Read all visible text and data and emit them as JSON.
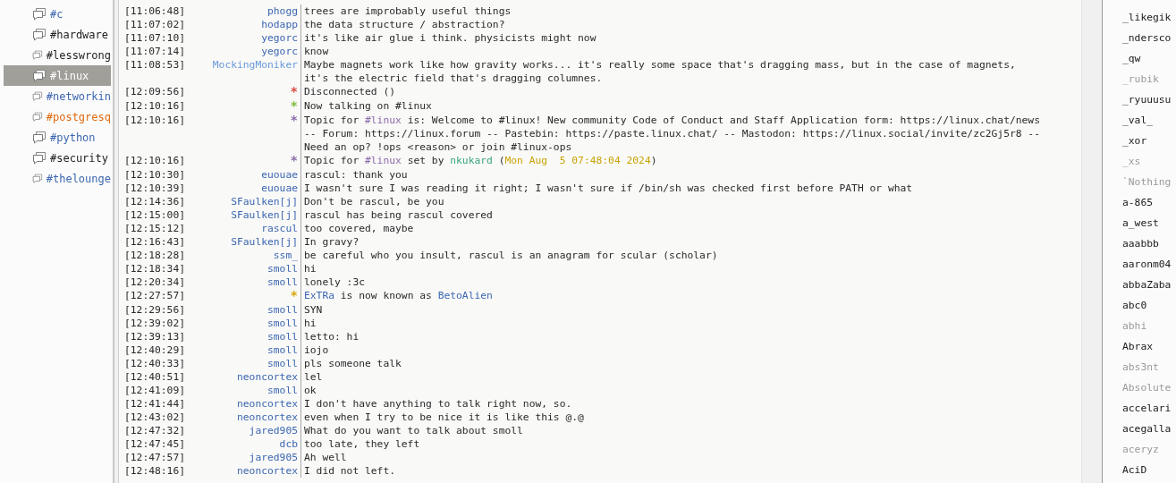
{
  "channels": [
    {
      "name": "#c",
      "color": "#3c67b0",
      "selected": false
    },
    {
      "name": "#hardware",
      "color": "#222222",
      "selected": false
    },
    {
      "name": "#lesswrong",
      "color": "#222222",
      "selected": false
    },
    {
      "name": "#linux",
      "color": "#ffffff",
      "selected": true
    },
    {
      "name": "#networkin",
      "color": "#3c67b0",
      "selected": false
    },
    {
      "name": "#postgresq",
      "color": "#e06a10",
      "selected": false
    },
    {
      "name": "#python",
      "color": "#3c67b0",
      "selected": false
    },
    {
      "name": "#security",
      "color": "#222222",
      "selected": false
    },
    {
      "name": "#thelounge",
      "color": "#3c67b0",
      "selected": false
    }
  ],
  "messages": [
    {
      "time": "[11:06:48]",
      "nick": "phogg",
      "color": "#3c67b0",
      "text": "trees are improbably useful things"
    },
    {
      "time": "[11:07:02]",
      "nick": "hodapp",
      "color": "#3c67b0",
      "text": "the data structure / abstraction?"
    },
    {
      "time": "[11:07:10]",
      "nick": "yegorc",
      "color": "#3c67b0",
      "text": "it's like air glue i think. physicists might now"
    },
    {
      "time": "[11:07:14]",
      "nick": "yegorc",
      "color": "#3c67b0",
      "text": "know"
    },
    {
      "time": "[11:08:53]",
      "nick": "MockingMoniker",
      "color": "#6a9ad8",
      "text": "Maybe magnets work like how gravity works... it's really some space that's dragging mass, but in the case of magnets, it's the electric field that's dragging columnes."
    },
    {
      "time": "[12:09:56]",
      "nick": "*",
      "kind": "event",
      "color": "#d9443c",
      "text": "Disconnected ()"
    },
    {
      "time": "[12:10:16]",
      "nick": "*",
      "kind": "event",
      "color": "#7dbb3c",
      "text": "Now talking on #linux"
    },
    {
      "time": "[12:10:16]",
      "nick": "*",
      "kind": "event",
      "color": "#8a6aa8",
      "parts": [
        {
          "text": "Topic for "
        },
        {
          "text": "#linux",
          "color": "#8a6aa8"
        },
        {
          "text": " is: Welcome to #linux! New community Code of Conduct and Staff Application form: https://linux.chat/news -- Forum: https://linux.forum -- Pastebin: https://paste.linux.chat/ -- Mastodon: https://linux.social/invite/zc2Gj5r8 -- Need an op? !ops <reason> or join #linux-ops"
        }
      ]
    },
    {
      "time": "[12:10:16]",
      "nick": "*",
      "kind": "event",
      "color": "#8a6aa8",
      "parts": [
        {
          "text": "Topic for "
        },
        {
          "text": "#linux",
          "color": "#8a6aa8"
        },
        {
          "text": " set by "
        },
        {
          "text": "nkukard",
          "color": "#3aa57a"
        },
        {
          "text": " ("
        },
        {
          "text": "Mon Aug  5 07:48:04 2024",
          "color": "#c9a200"
        },
        {
          "text": ")"
        }
      ]
    },
    {
      "time": "[12:10:30]",
      "nick": "euouae",
      "color": "#3c67b0",
      "text": "rascul: thank you"
    },
    {
      "time": "[12:10:39]",
      "nick": "euouae",
      "color": "#3c67b0",
      "text": "I wasn't sure I was reading it right; I wasn't sure if /bin/sh was checked first before PATH or what"
    },
    {
      "time": "[12:14:36]",
      "nick": "SFaulken[j]",
      "color": "#3c67b0",
      "text": "Don't be rascul, be you"
    },
    {
      "time": "[12:15:00]",
      "nick": "SFaulken[j]",
      "color": "#3c67b0",
      "text": "rascul has being rascul covered"
    },
    {
      "time": "[12:15:12]",
      "nick": "rascul",
      "color": "#3c67b0",
      "text": "too covered, maybe"
    },
    {
      "time": "[12:16:43]",
      "nick": "SFaulken[j]",
      "color": "#3c67b0",
      "text": "In gravy?"
    },
    {
      "time": "[12:18:28]",
      "nick": "ssm_",
      "color": "#3c67b0",
      "text": "be careful who you insult, rascul is an anagram for scular (scholar)"
    },
    {
      "time": "[12:18:34]",
      "nick": "smoll",
      "color": "#3c67b0",
      "text": "hi"
    },
    {
      "time": "[12:20:34]",
      "nick": "smoll",
      "color": "#3c67b0",
      "text": "lonely :3c"
    },
    {
      "time": "[12:27:57]",
      "nick": "*",
      "kind": "event",
      "color": "#d9a400",
      "parts": [
        {
          "text": "ExTRa",
          "color": "#3c67b0"
        },
        {
          "text": " is now known as "
        },
        {
          "text": "BetoAlien",
          "color": "#3c67b0"
        }
      ]
    },
    {
      "time": "[12:29:56]",
      "nick": "smoll",
      "color": "#3c67b0",
      "text": "SYN"
    },
    {
      "time": "[12:39:02]",
      "nick": "smoll",
      "color": "#3c67b0",
      "text": "hi"
    },
    {
      "time": "[12:39:13]",
      "nick": "smoll",
      "color": "#3c67b0",
      "text": "letto: hi"
    },
    {
      "time": "[12:40:29]",
      "nick": "smoll",
      "color": "#3c67b0",
      "text": "iojo"
    },
    {
      "time": "[12:40:33]",
      "nick": "smoll",
      "color": "#3c67b0",
      "text": "pls someone talk"
    },
    {
      "time": "[12:40:51]",
      "nick": "neoncortex",
      "color": "#3c67b0",
      "text": "lel"
    },
    {
      "time": "[12:41:09]",
      "nick": "smoll",
      "color": "#3c67b0",
      "text": "ok"
    },
    {
      "time": "[12:41:44]",
      "nick": "neoncortex",
      "color": "#3c67b0",
      "text": "I don't have anything to talk right now, so."
    },
    {
      "time": "[12:43:02]",
      "nick": "neoncortex",
      "color": "#3c67b0",
      "text": "even when I try to be nice it is like this @.@"
    },
    {
      "time": "[12:47:32]",
      "nick": "jared905",
      "color": "#3c67b0",
      "text": "What do you want to talk about smoll"
    },
    {
      "time": "[12:47:45]",
      "nick": "dcb",
      "color": "#3c67b0",
      "text": "too late, they left"
    },
    {
      "time": "[12:47:57]",
      "nick": "jared905",
      "color": "#3c67b0",
      "text": "Ah well"
    },
    {
      "time": "[12:48:16]",
      "nick": "neoncortex",
      "color": "#3c67b0",
      "text": "I did not left."
    }
  ],
  "users": [
    {
      "name": "_likegik",
      "away": false
    },
    {
      "name": "_ndersco",
      "away": false
    },
    {
      "name": "_qw",
      "away": false
    },
    {
      "name": "_rubik",
      "away": true
    },
    {
      "name": "_ryuuusu",
      "away": false
    },
    {
      "name": "_val_",
      "away": false
    },
    {
      "name": "_xor",
      "away": false
    },
    {
      "name": "_xs",
      "away": true
    },
    {
      "name": "`Nothing",
      "away": true
    },
    {
      "name": "a-865",
      "away": false
    },
    {
      "name": "a_west",
      "away": false
    },
    {
      "name": "aaabbb",
      "away": false
    },
    {
      "name": "aaronm04",
      "away": false
    },
    {
      "name": "abbaZaba",
      "away": false
    },
    {
      "name": "abc0",
      "away": false
    },
    {
      "name": "abhi",
      "away": true
    },
    {
      "name": "Abrax",
      "away": false
    },
    {
      "name": "abs3nt",
      "away": true
    },
    {
      "name": "Absolute",
      "away": true
    },
    {
      "name": "accelari",
      "away": false
    },
    {
      "name": "acegalla",
      "away": false
    },
    {
      "name": "aceryz",
      "away": true
    },
    {
      "name": "AciD",
      "away": false
    }
  ]
}
